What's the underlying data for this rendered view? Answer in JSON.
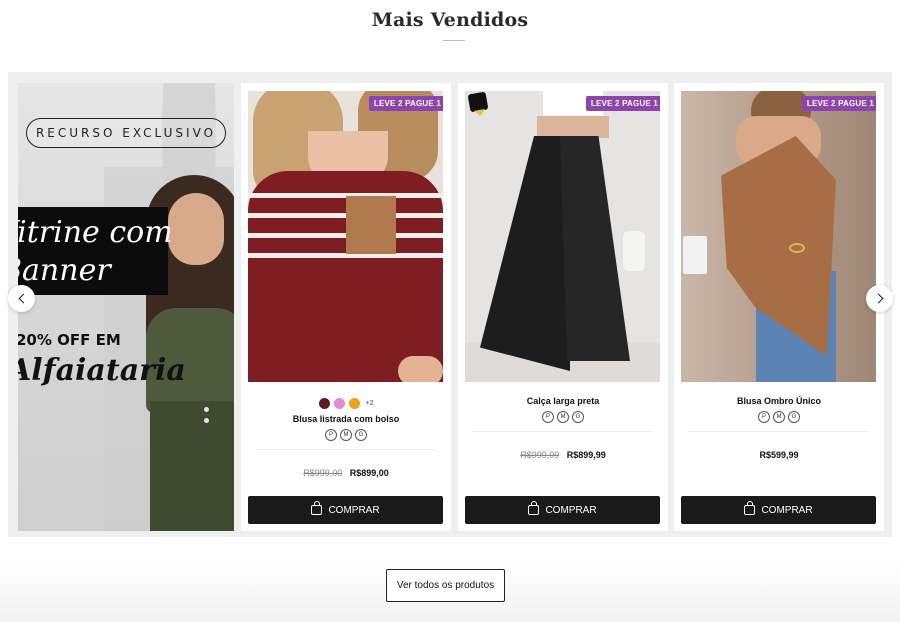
{
  "section": {
    "title": "Mais Vendidos"
  },
  "banner": {
    "pill_text": "RECURSO EXCLUSIVO",
    "line1": "Vitrine com",
    "line2": "Banner",
    "line3": "20% OFF EM",
    "line4": "Alfaiataria"
  },
  "products": [
    {
      "badge": "LEVE 2 PAGUE 1",
      "swatches": [
        "#5e1a2b",
        "#e48ad8",
        "#f1a21b"
      ],
      "more_colors": "+2",
      "name": "Blusa listrada com bolso",
      "sizes": [
        "P",
        "M",
        "G"
      ],
      "old_price": "R$999,00",
      "price": "R$899,00",
      "buy_label": "COMPRAR"
    },
    {
      "badge": "LEVE 2 PAGUE 1",
      "name": "Calça larga preta",
      "sizes": [
        "P",
        "M",
        "G"
      ],
      "old_price": "R$999,99",
      "price": "R$899,99",
      "buy_label": "COMPRAR"
    },
    {
      "badge": "LEVE 2 PAGUE 1",
      "name": "Blusa Ombro Único",
      "sizes": [
        "P",
        "M",
        "G"
      ],
      "price": "R$599,99",
      "buy_label": "COMPRAR"
    }
  ],
  "view_all_label": "Ver todos os produtos",
  "colors": {
    "badge": "#8e44ad",
    "button": "#1a1a1a",
    "carousel_bg": "#eeefef"
  },
  "icons": {
    "prev": "chevron-left-icon",
    "next": "chevron-right-icon",
    "buy": "shopping-bag-icon"
  }
}
